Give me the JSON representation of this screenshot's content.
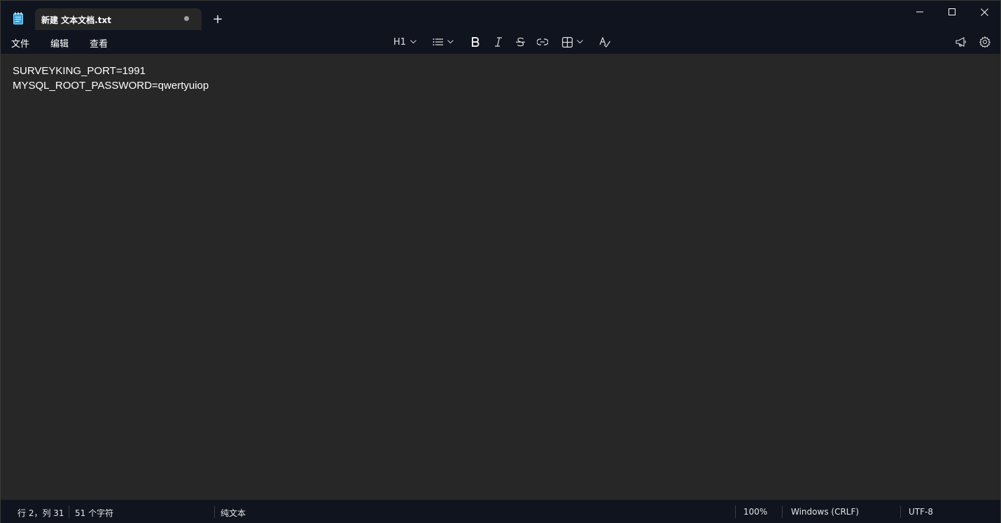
{
  "window": {
    "tab_title": "新建 文本文档.txt",
    "new_tab_label": "+",
    "app_icon": "notepad-icon",
    "unsaved_indicator": "dot"
  },
  "menu": {
    "file": "文件",
    "edit": "编辑",
    "view": "查看"
  },
  "toolbar": {
    "heading_label": "H1",
    "icons": [
      "list-icon",
      "bold-icon",
      "italic-icon",
      "strikethrough-icon",
      "link-icon",
      "table-icon",
      "spellcheck-icon",
      "copilot-icon",
      "settings-icon"
    ]
  },
  "editor": {
    "lines": [
      "SURVEYKING_PORT=1991",
      "MYSQL_ROOT_PASSWORD=qwertyuiop"
    ]
  },
  "status": {
    "position": "行 2，列 31",
    "char_count": "51 个字符",
    "format": "纯文本",
    "zoom": "100%",
    "line_ending": "Windows (CRLF)",
    "encoding": "UTF-8"
  },
  "colors": {
    "chrome": "#10141f",
    "editor_bg": "#272727",
    "text": "#ffffff",
    "icon_blue": "#4fc3f7"
  }
}
